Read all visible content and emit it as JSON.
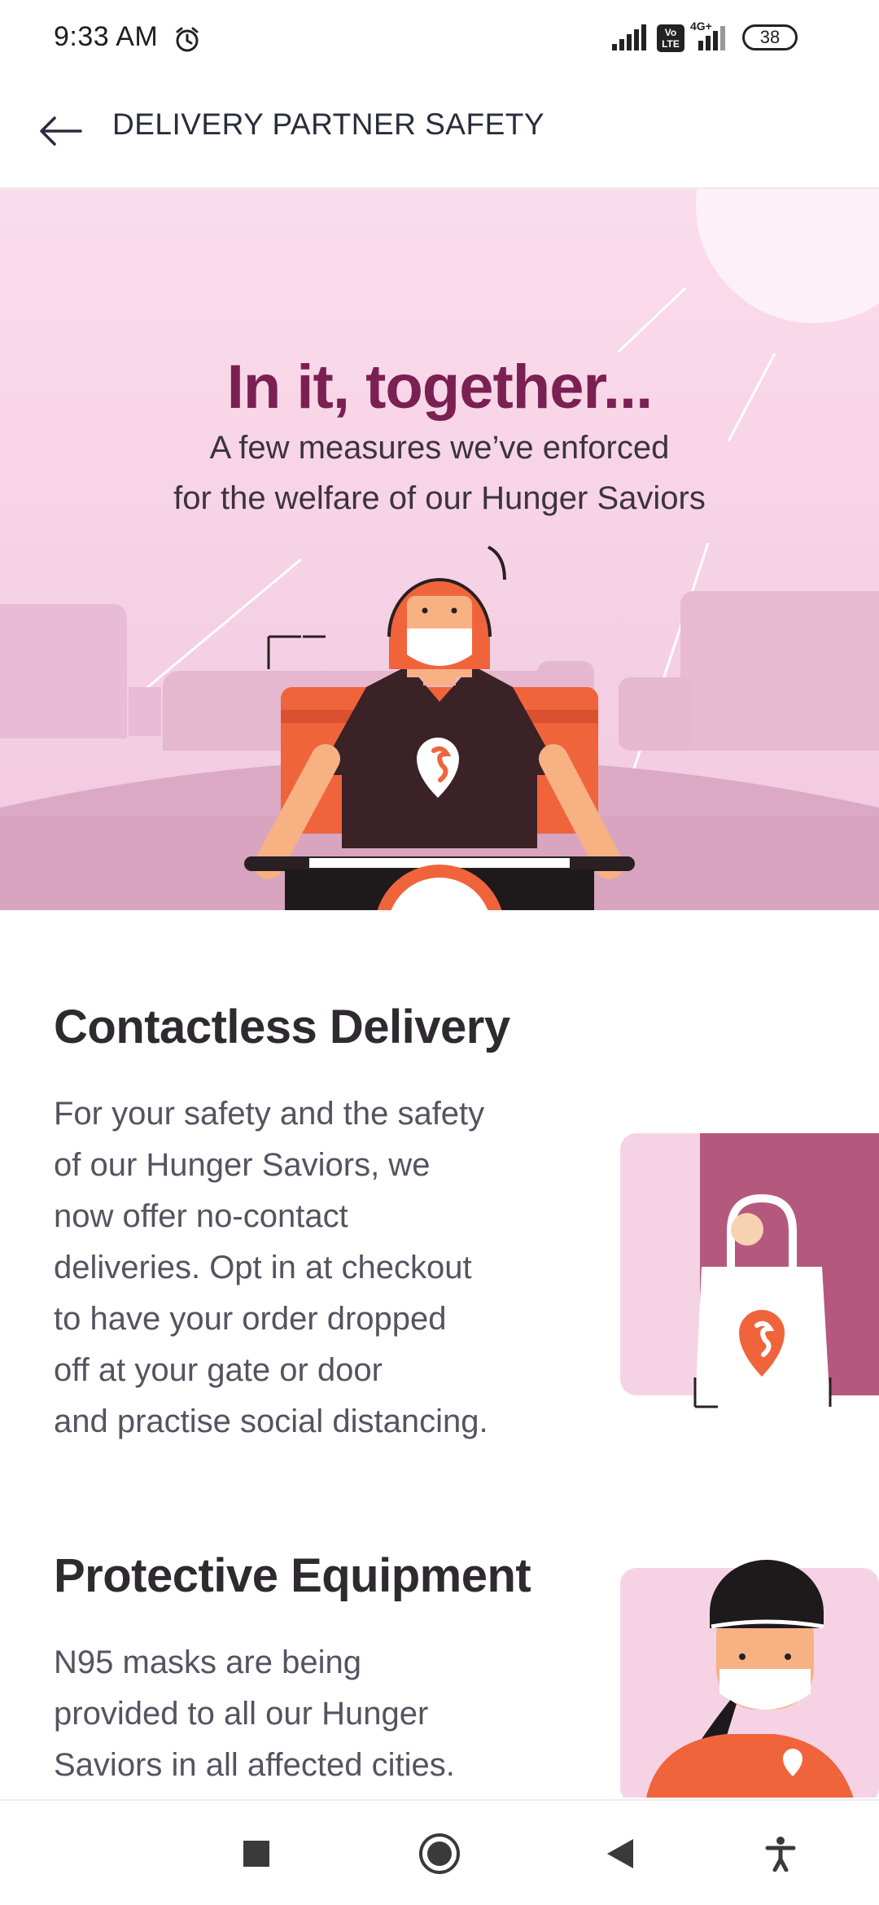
{
  "status_bar": {
    "time": "9:33 AM",
    "battery": "38",
    "volte_label": "Vo LTE",
    "network_label": "4G+"
  },
  "header": {
    "title": "DELIVERY PARTNER SAFETY",
    "back_icon": "arrow-left-icon"
  },
  "hero": {
    "title": "In it, together...",
    "subtitle_line1": "A few measures we’ve enforced",
    "subtitle_line2": "for the welfare of our Hunger Saviors"
  },
  "sections": [
    {
      "title": "Contactless Delivery",
      "lines": [
        "For your safety and the safety",
        "of our Hunger Saviors, we",
        "now offer no-contact",
        "deliveries. Opt in at checkout",
        "to have your order dropped",
        "off at your gate or door",
        "and practise social distancing."
      ]
    },
    {
      "title": "Protective Equipment",
      "lines": [
        "N95 masks are being",
        "provided to all our Hunger",
        "Saviors in all affected cities."
      ]
    }
  ],
  "nav": {
    "icons": [
      "square-icon",
      "home-circle-icon",
      "back-triangle-icon",
      "accessibility-icon"
    ]
  },
  "colors": {
    "brand_orange": "#f0643c",
    "brand_plum": "#7b2052",
    "hero_pink": "#f8d9ea",
    "card_magenta": "#b5587e"
  }
}
